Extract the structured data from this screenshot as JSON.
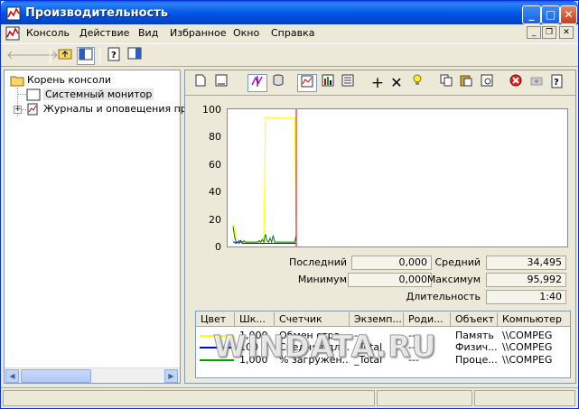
{
  "window": {
    "title": "Производительность",
    "menu": [
      "Консоль",
      "Действие",
      "Вид",
      "Избранное",
      "Окно",
      "Справка"
    ]
  },
  "toolbar": {
    "items": [
      "back-arrow-icon",
      "forward-arrow-icon",
      "up-level-icon",
      "show-hide-tree-icon",
      "help-icon",
      "show-hide-action-pane-icon"
    ]
  },
  "tree": {
    "items": [
      {
        "label": "Корень консоли",
        "icon": "folder-icon"
      },
      {
        "label": "Системный монитор",
        "icon": "chart-icon",
        "selected": true
      },
      {
        "label": "Журналы и оповещения прои",
        "icon": "logs-icon"
      }
    ]
  },
  "monitor": {
    "toolbar_icons": [
      "new-counter-set-icon",
      "clear-display-icon",
      "view-current-activity-icon",
      "view-log-data-icon",
      "view-graph-icon",
      "view-histogram-icon",
      "view-report-icon",
      "add-icon",
      "delete-icon",
      "highlight-icon",
      "copy-properties-icon",
      "paste-counter-list-icon",
      "properties-icon",
      "freeze-display-icon",
      "update-data-icon",
      "help-icon"
    ],
    "y_ticks": [
      "100",
      "80",
      "60",
      "40",
      "20",
      "0"
    ],
    "stats": {
      "last_label": "Последний",
      "last_value": "0,000",
      "avg_label": "Средний",
      "avg_value": "34,495",
      "min_label": "Минимум",
      "min_value": "0,000",
      "max_label": "Максимум",
      "max_value": "95,992",
      "duration_label": "Длительность",
      "duration_value": "1:40"
    },
    "legend_headers": [
      "Цвет",
      "Шк...",
      "Счетчик",
      "Экземп...",
      "Роди...",
      "Объект",
      "Компьютер"
    ],
    "legend_rows": [
      {
        "color": "#ffff00",
        "scale": "1,000",
        "counter": "Обмен стра...",
        "instance": "---",
        "parent": "---",
        "object": "Память",
        "computer": "\\\\COMPEG"
      },
      {
        "color": "#0000ff",
        "scale": "100",
        "counter": "Средняя дл...",
        "instance": "_Total",
        "parent": "---",
        "object": "Физич...",
        "computer": "\\\\COMPEG"
      },
      {
        "color": "#00a000",
        "scale": "1,000",
        "counter": "% загружен...",
        "instance": "_Total",
        "parent": "---",
        "object": "Проце...",
        "computer": "\\\\COMPEG"
      }
    ]
  },
  "chart_data": {
    "type": "line",
    "ylim": [
      0,
      100
    ],
    "series": [
      {
        "color": "#ffff00",
        "values": [
          16,
          14,
          2,
          2,
          2,
          2,
          2,
          2,
          2,
          2,
          2,
          2,
          2,
          2,
          2,
          2,
          2,
          2,
          2,
          2,
          2,
          96,
          96,
          96,
          96,
          96,
          96,
          96,
          96,
          96,
          96,
          96,
          96,
          96,
          96,
          96,
          96,
          96,
          96,
          96,
          96,
          0
        ]
      },
      {
        "color": "#0000ff",
        "values": [
          2,
          2,
          1,
          2,
          1,
          3,
          1,
          1,
          1,
          1,
          1,
          1,
          1,
          1,
          1,
          1,
          1,
          1,
          1,
          1,
          1,
          1,
          1,
          1,
          1,
          1,
          1,
          1,
          1,
          1,
          1,
          1,
          1,
          1,
          1,
          1,
          1,
          1,
          1,
          1,
          1,
          1
        ]
      },
      {
        "color": "#008000",
        "values": [
          14,
          6,
          2,
          2,
          3,
          2,
          2,
          3,
          2,
          2,
          2,
          2,
          2,
          2,
          2,
          2,
          2,
          3,
          2,
          4,
          2,
          8,
          3,
          2,
          5,
          2,
          7,
          2,
          2,
          2,
          2,
          2,
          2,
          2,
          2,
          2,
          2,
          2,
          2,
          2,
          2,
          7
        ]
      }
    ]
  },
  "watermark": "WINDATA.RU"
}
